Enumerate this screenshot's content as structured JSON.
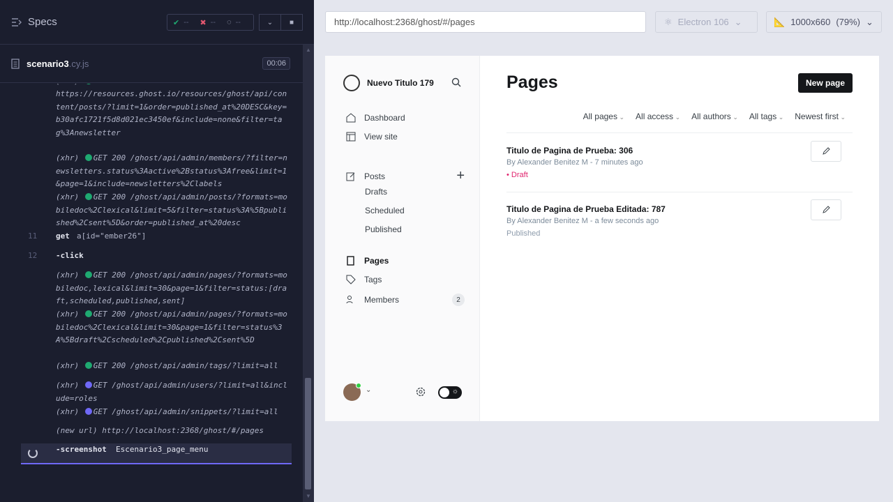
{
  "runner": {
    "title": "Specs",
    "stats": {
      "passed": "--",
      "failed": "--",
      "pending": "--"
    },
    "file": {
      "name": "scenario3",
      "ext": ".cy.js",
      "timer": "00:06"
    },
    "log": [
      {
        "kind": "text",
        "text": "https://resources.ghost.io/resources/ghost/api/content/posts/?limit=1&order=published_at%20DESC&key=b30afc1721f5d8d021ec3450ef&include=none&filter=tag%3Anewsletter"
      },
      {
        "kind": "xhr",
        "prefix": "(xhr)",
        "dot": "green",
        "text": "GET 200 /ghost/api/admin/members/?filter=newsletters.status%3Aactive%2Bstatus%3Afree&limit=1&page=1&include=newsletters%2Clabels"
      },
      {
        "kind": "xhr",
        "prefix": "(xhr)",
        "dot": "green",
        "text": "GET 200 /ghost/api/admin/posts/?formats=mobiledoc%2Clexical&limit=5&filter=status%3A%5Bpublished%2Csent%5D&order=published_at%20desc"
      },
      {
        "kind": "cmd",
        "num": "11",
        "cmd": "get",
        "arg": "a[id=\"ember26\"]"
      },
      {
        "kind": "cmd",
        "num": "12",
        "cmd": "-click",
        "arg": ""
      },
      {
        "kind": "xhr",
        "prefix": "(xhr)",
        "dot": "green",
        "text": "GET 200 /ghost/api/admin/pages/?formats=mobiledoc,lexical&limit=30&page=1&filter=status:[draft,scheduled,published,sent]"
      },
      {
        "kind": "xhr",
        "prefix": "(xhr)",
        "dot": "green",
        "text": "GET 200 /ghost/api/admin/pages/?formats=mobiledoc%2Clexical&limit=30&page=1&filter=status%3A%5Bdraft%2Cscheduled%2Cpublished%2Csent%5D"
      },
      {
        "kind": "xhr",
        "prefix": "(xhr)",
        "dot": "green",
        "text": "GET 200 /ghost/api/admin/tags/?limit=all"
      },
      {
        "kind": "xhr",
        "prefix": "(xhr)",
        "dot": "blue",
        "text": "GET /ghost/api/admin/users/?limit=all&include=roles"
      },
      {
        "kind": "xhr",
        "prefix": "(xhr)",
        "dot": "blue",
        "text": "GET /ghost/api/admin/snippets/?limit=all"
      },
      {
        "kind": "text",
        "text": "(new url)  http://localhost:2368/ghost/#/pages"
      }
    ],
    "active_cmd": "-screenshot",
    "active_arg": "Escenario3_page_menu"
  },
  "browser": {
    "url": "http://localhost:2368/ghost/#/pages",
    "name": "Electron 106",
    "viewport": "1000x660",
    "zoom": "(79%)"
  },
  "ghost": {
    "site_title": "Nuevo Titulo 179",
    "nav": {
      "dashboard": "Dashboard",
      "view_site": "View site",
      "posts": "Posts",
      "drafts": "Drafts",
      "scheduled": "Scheduled",
      "published": "Published",
      "pages": "Pages",
      "tags": "Tags",
      "members": "Members",
      "members_count": "2"
    },
    "page_title": "Pages",
    "new_button": "New page",
    "filters": [
      "All pages",
      "All access",
      "All authors",
      "All tags",
      "Newest first"
    ],
    "rows": [
      {
        "title": "Titulo de Pagina de Prueba: 306",
        "meta": "By Alexander Benitez M - 7 minutes ago",
        "status": "Draft"
      },
      {
        "title": "Titulo de Pagina de Prueba Editada: 787",
        "meta": "By Alexander Benitez M - a few seconds ago",
        "status": "Published"
      }
    ]
  }
}
